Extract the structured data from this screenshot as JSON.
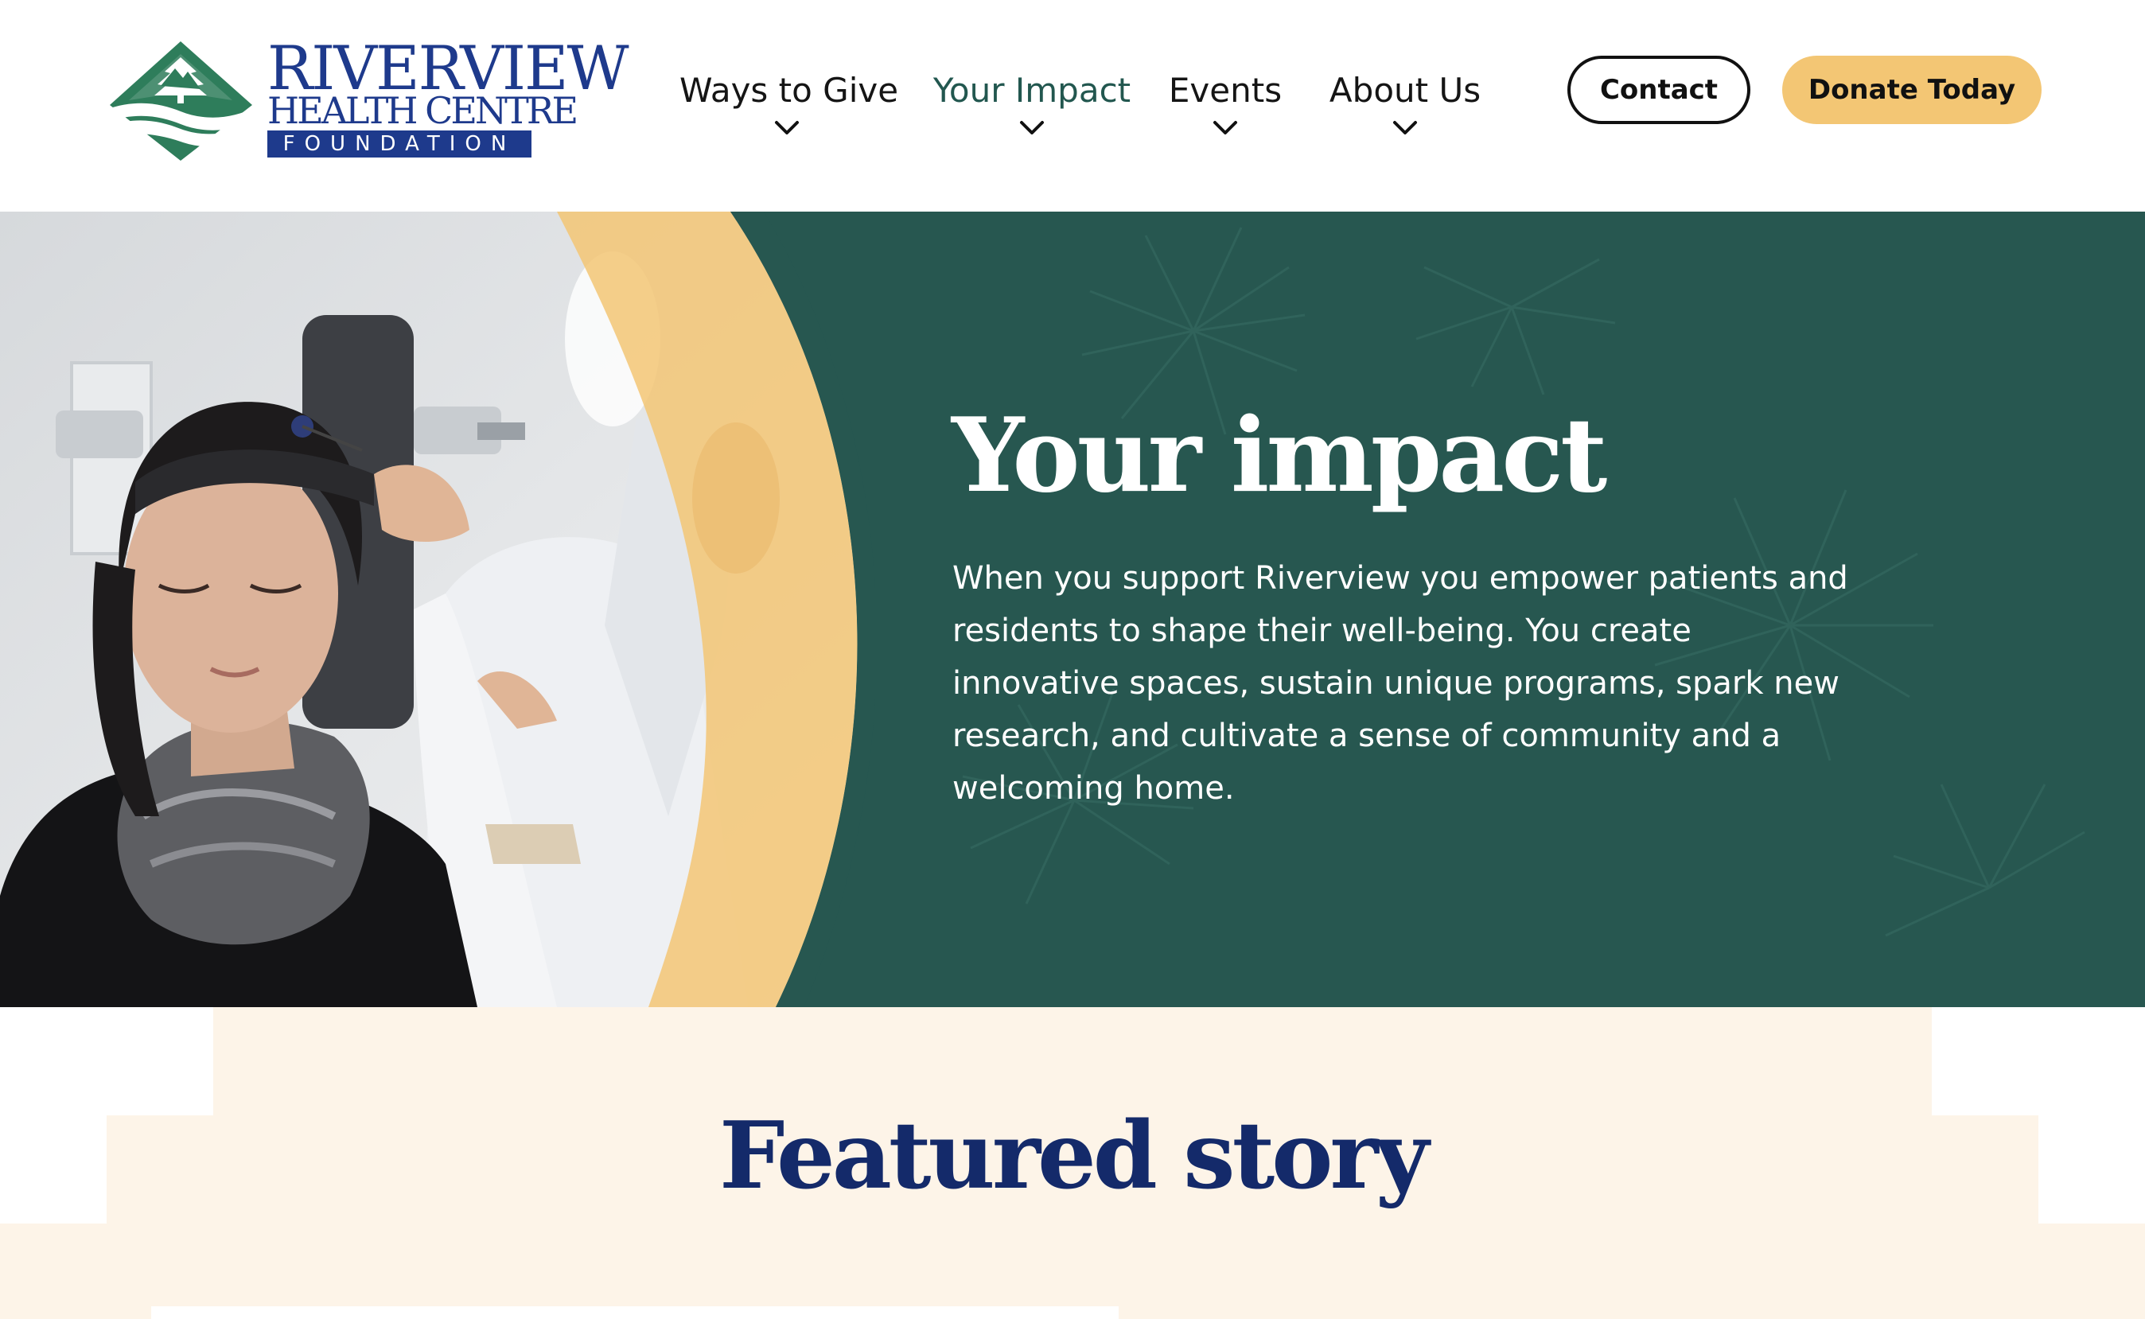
{
  "header": {
    "logo": {
      "line1": "RIVERVIEW",
      "line2": "HEALTH CENTRE",
      "line3": "FOUNDATION"
    },
    "nav": [
      {
        "label": "Ways to Give",
        "active": false
      },
      {
        "label": "Your Impact",
        "active": true
      },
      {
        "label": "Events",
        "active": false
      },
      {
        "label": "About Us",
        "active": false
      }
    ],
    "contact_label": "Contact",
    "donate_label": "Donate Today"
  },
  "hero": {
    "title": "Your impact",
    "body": "When you support Riverview you empower patients and residents to shape their well-being. You create innovative spaces, sustain unique programs, spark new research, and cultivate a sense of community and a welcoming home."
  },
  "featured": {
    "title": "Featured story"
  },
  "colors": {
    "brand_blue": "#1e3a8c",
    "brand_green": "#2e7d5b",
    "hero_green": "#275750",
    "accent_yellow": "#f3c674",
    "cream": "#fdf4e8",
    "heading_navy": "#142a6a"
  },
  "icons": {
    "nav_chevron": "chevron-down-icon",
    "logo_mark": "leaf-river-emblem-icon"
  }
}
